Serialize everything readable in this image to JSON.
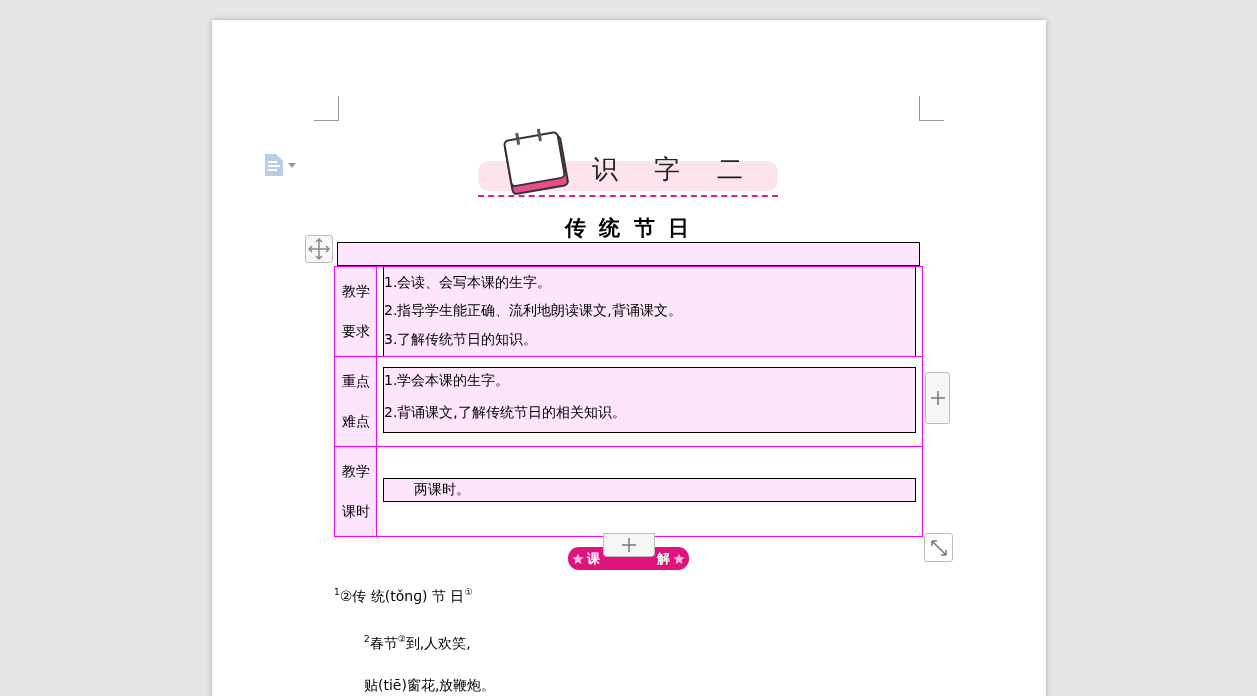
{
  "header": {
    "lesson_title": "识 字 二"
  },
  "title": "传 统 节 日",
  "table": {
    "rows": [
      {
        "kind": "shaded",
        "label": [
          "教学",
          "要求"
        ],
        "items": [
          "1.会读、会写本课的生字。",
          "2.指导学生能正确、流利地朗读课文,背诵课文。",
          "3.了解传统节日的知识。"
        ]
      },
      {
        "kind": "boxed",
        "label": [
          "重点",
          "难点"
        ],
        "items": [
          "1.学会本课的生字。",
          "2.背诵课文,了解传统节日的相关知识。"
        ]
      },
      {
        "kind": "indented",
        "label": [
          "教学",
          "课时"
        ],
        "items": [
          "两课时。"
        ]
      }
    ]
  },
  "badge": {
    "left": "课",
    "right": "解"
  },
  "text_lines": [
    {
      "text": "$^{1}$②传 统(tǒnɡ) 节 日$^{①}$",
      "indent": false
    },
    {
      "text": "$^{2}$春节$^{②}$到,人欢笑,",
      "indent": true
    },
    {
      "text": "贴(tiē)窗花,放鞭炮。",
      "indent": true
    }
  ]
}
